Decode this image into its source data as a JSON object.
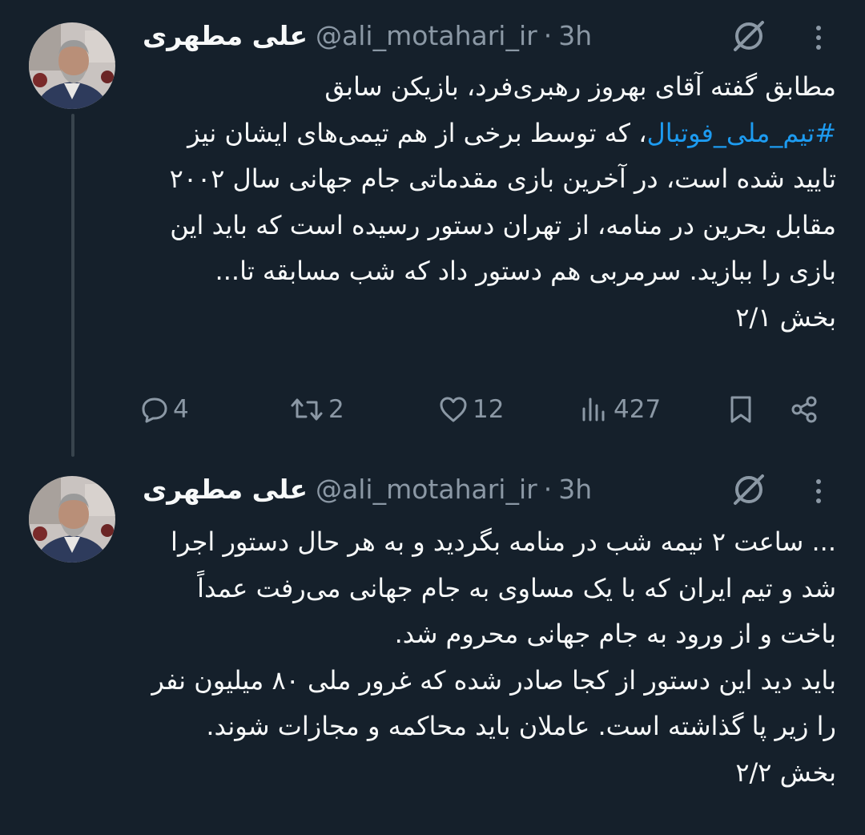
{
  "tweets": [
    {
      "display_name": "علی مطهری",
      "handle": "@ali_motahari_ir",
      "separator": "·",
      "time": "3h",
      "text_before": "مطابق گفته آقای بهروز رهبری‌فرد، بازیکن سابق\n",
      "hashtag": "#تیم_ملی_فوتبال",
      "text_after": "، که توسط برخی از هم تیمی‌های ایشان نیز تایید شده است، در آخرین بازی مقدماتی جام جهانی سال ۲۰۰۲ مقابل بحرین در منامه، از تهران دستور رسیده است که باید این بازی را ببازید. سرمربی هم دستور داد که شب مسابقه تا...\nبخش ۲/۱",
      "replies": "4",
      "retweets": "2",
      "likes": "12",
      "views": "427"
    },
    {
      "display_name": "علی مطهری",
      "handle": "@ali_motahari_ir",
      "separator": "·",
      "time": "3h",
      "text": "... ساعت ۲ نیمه شب در منامه بگردید و به هر حال دستور اجرا شد و تیم ایران که با یک مساوی به جام جهانی می‌رفت  عمداً باخت و از ورود به جام جهانی محروم شد.\nباید دید این دستور از کجا صادر شده که غرور ملی ۸۰ میلیون نفر را زیر پا گذاشته است. عاملان باید محاکمه و مجازات شوند.\nبخش ۲/۲"
    }
  ],
  "icons": {
    "grok": "grok-icon",
    "more": "more-dots-icon",
    "reply": "reply-icon",
    "retweet": "retweet-icon",
    "like": "heart-icon",
    "views": "views-icon",
    "bookmark": "bookmark-icon",
    "share": "share-icon"
  },
  "colors": {
    "background": "#15202b",
    "text": "#f7f9f9",
    "secondary": "#8b98a5",
    "link": "#1d9bf0",
    "thread_line": "#38444d"
  }
}
